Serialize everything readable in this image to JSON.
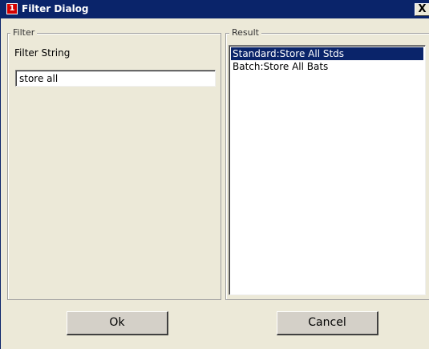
{
  "window": {
    "title": "Filter Dialog",
    "close_glyph": "X",
    "icon_glyph": "1"
  },
  "filter": {
    "group_label": "Filter",
    "field_label": "Filter String",
    "value": "store all"
  },
  "result": {
    "group_label": "Result",
    "items": [
      {
        "label": "Standard:Store All Stds",
        "selected": true
      },
      {
        "label": "Batch:Store All Bats",
        "selected": false
      }
    ]
  },
  "buttons": {
    "ok": "Ok",
    "cancel": "Cancel"
  },
  "colors": {
    "titlebar": "#0a246a",
    "selection": "#0a246a",
    "dialog_bg": "#ece9d8"
  }
}
